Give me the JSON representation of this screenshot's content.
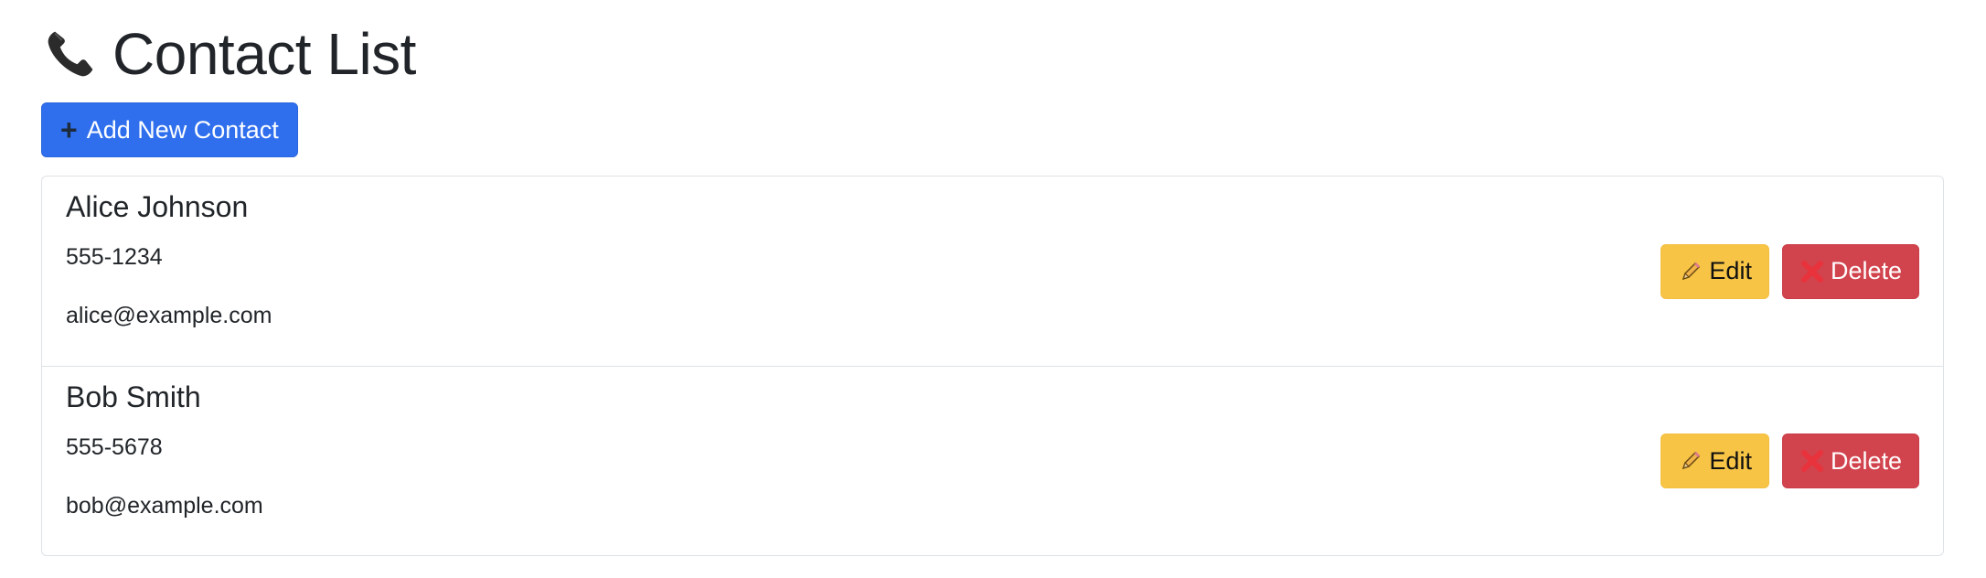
{
  "header": {
    "title": "Contact List",
    "title_icon": "telephone-icon"
  },
  "toolbar": {
    "add_button_label": "Add New Contact",
    "add_icon": "plus-icon"
  },
  "contacts": [
    {
      "name": "Alice Johnson",
      "phone": "555-1234",
      "email": "alice@example.com",
      "edit_label": "Edit",
      "delete_label": "Delete"
    },
    {
      "name": "Bob Smith",
      "phone": "555-5678",
      "email": "bob@example.com",
      "edit_label": "Edit",
      "delete_label": "Delete"
    }
  ],
  "colors": {
    "primary": "#2f6fee",
    "warning": "#f7c446",
    "danger": "#d1434d",
    "border": "#dee2e6"
  }
}
